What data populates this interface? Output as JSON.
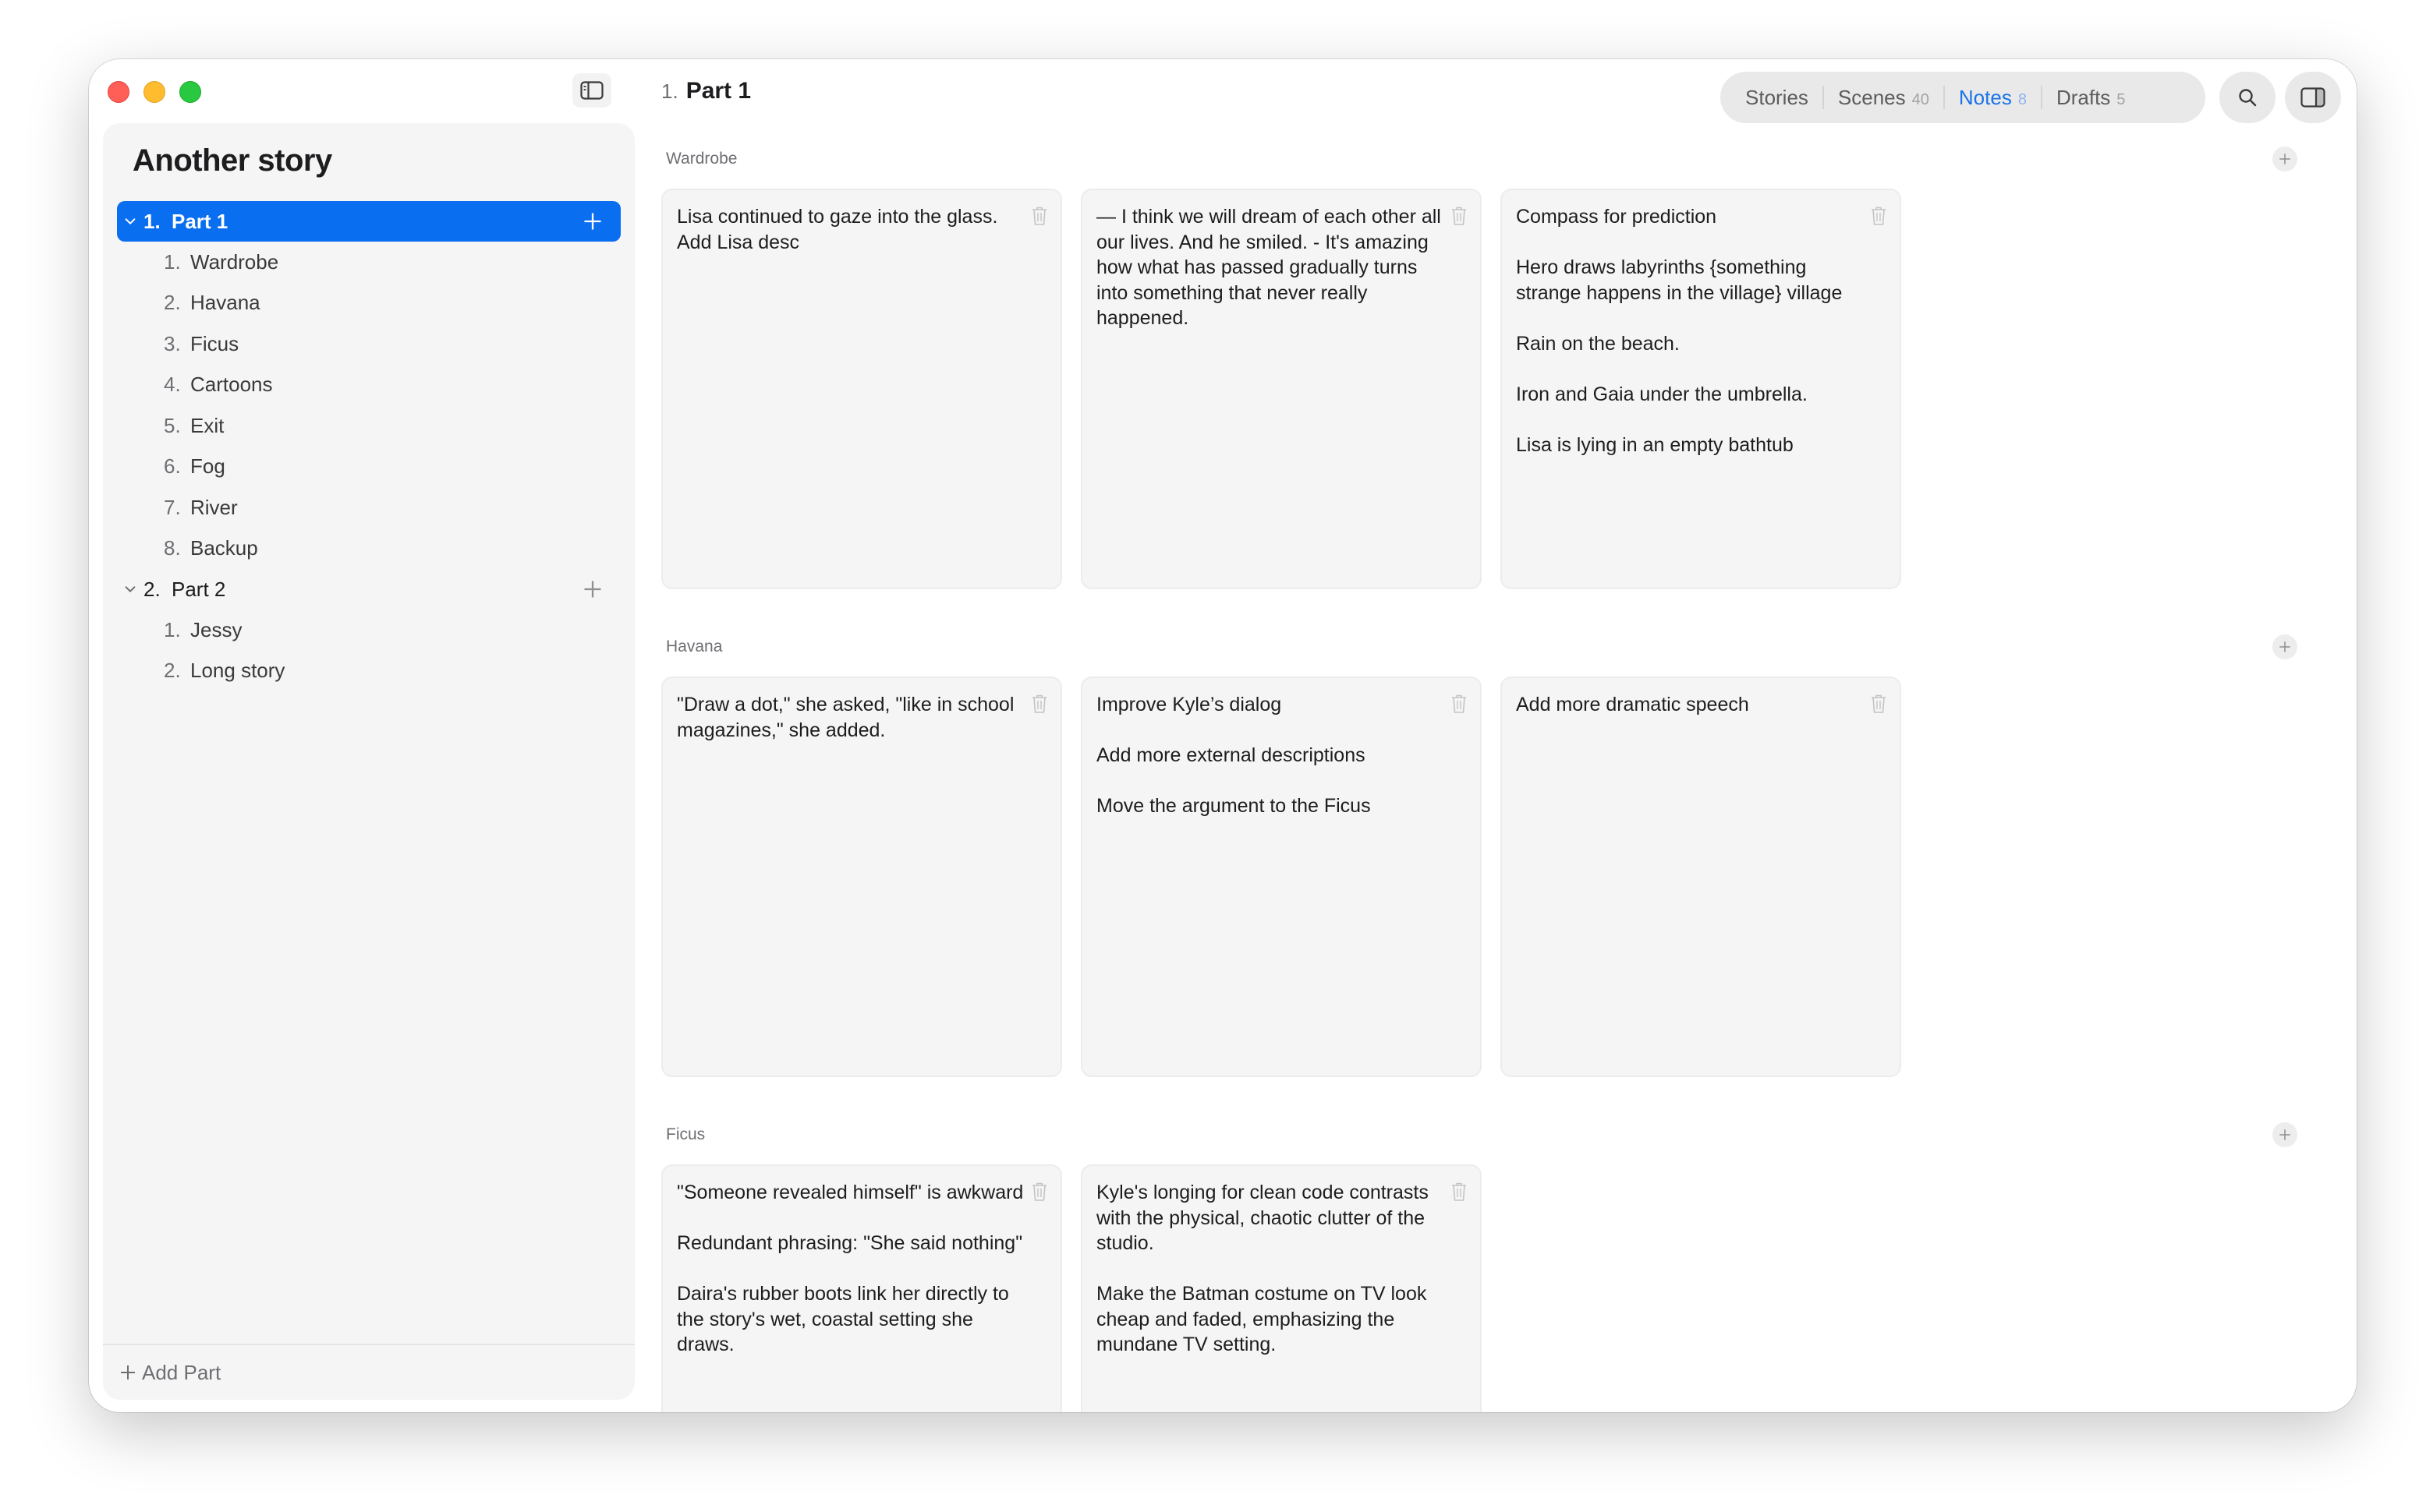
{
  "window": {
    "sidebar_toggle_icon": "sidebar-left-icon"
  },
  "sidebar": {
    "story_title": "Another story",
    "parts": [
      {
        "number": "1.",
        "title": "Part 1",
        "expanded": true,
        "selected": true,
        "scenes": [
          {
            "number": "1.",
            "title": "Wardrobe"
          },
          {
            "number": "2.",
            "title": "Havana"
          },
          {
            "number": "3.",
            "title": "Ficus"
          },
          {
            "number": "4.",
            "title": "Cartoons"
          },
          {
            "number": "5.",
            "title": "Exit"
          },
          {
            "number": "6.",
            "title": "Fog"
          },
          {
            "number": "7.",
            "title": "River"
          },
          {
            "number": "8.",
            "title": "Backup"
          }
        ]
      },
      {
        "number": "2.",
        "title": "Part 2",
        "expanded": true,
        "selected": false,
        "scenes": [
          {
            "number": "1.",
            "title": "Jessy"
          },
          {
            "number": "2.",
            "title": "Long story"
          }
        ]
      }
    ],
    "add_part_label": "Add Part"
  },
  "header": {
    "number": "1.",
    "title": "Part 1",
    "tabs": [
      {
        "label": "Stories",
        "count": ""
      },
      {
        "label": "Scenes",
        "count": "40"
      },
      {
        "label": "Notes",
        "count": "8",
        "active": true
      },
      {
        "label": "Drafts",
        "count": "5"
      }
    ],
    "search_icon": "search-icon",
    "inspector_icon": "sidebar-right-icon"
  },
  "sections": [
    {
      "label": "Wardrobe",
      "cards": [
        {
          "text": "Lisa continued to gaze into the glass.\nAdd Lisa desc"
        },
        {
          "text": "— I think we will dream of each other all our lives. And he smiled. - It's amazing how what has passed gradually turns into something that never really happened."
        },
        {
          "text": "Compass for prediction\n\nHero draws labyrinths {something strange happens in the village} village\n\nRain on the beach.\n\nIron and Gaia under the umbrella.\n\nLisa is lying in an empty bathtub"
        }
      ]
    },
    {
      "label": "Havana",
      "cards": [
        {
          "text": "\"Draw a dot,\" she asked, \"like in school magazines,\" she added."
        },
        {
          "text": "Improve Kyle’s dialog\n\nAdd more external descriptions\n\nMove the argument to the Ficus"
        },
        {
          "text": "Add more dramatic speech"
        }
      ]
    },
    {
      "label": "Ficus",
      "cards": [
        {
          "text": "\"Someone revealed himself\" is awkward\n\nRedundant phrasing: \"She said nothing\"\n\nDaira's rubber boots link her directly to the story's wet, coastal setting she draws."
        },
        {
          "text": "Kyle's longing for clean code contrasts with the physical, chaotic clutter of the studio.\n\nMake the Batman costume on TV look cheap and faded, emphasizing the mundane TV setting."
        }
      ]
    }
  ],
  "colors": {
    "accent": "#0a6ef0",
    "active_tab": "#1a73e8",
    "close": "#ff5f57",
    "minimize": "#febc2e",
    "zoom": "#28c840"
  }
}
